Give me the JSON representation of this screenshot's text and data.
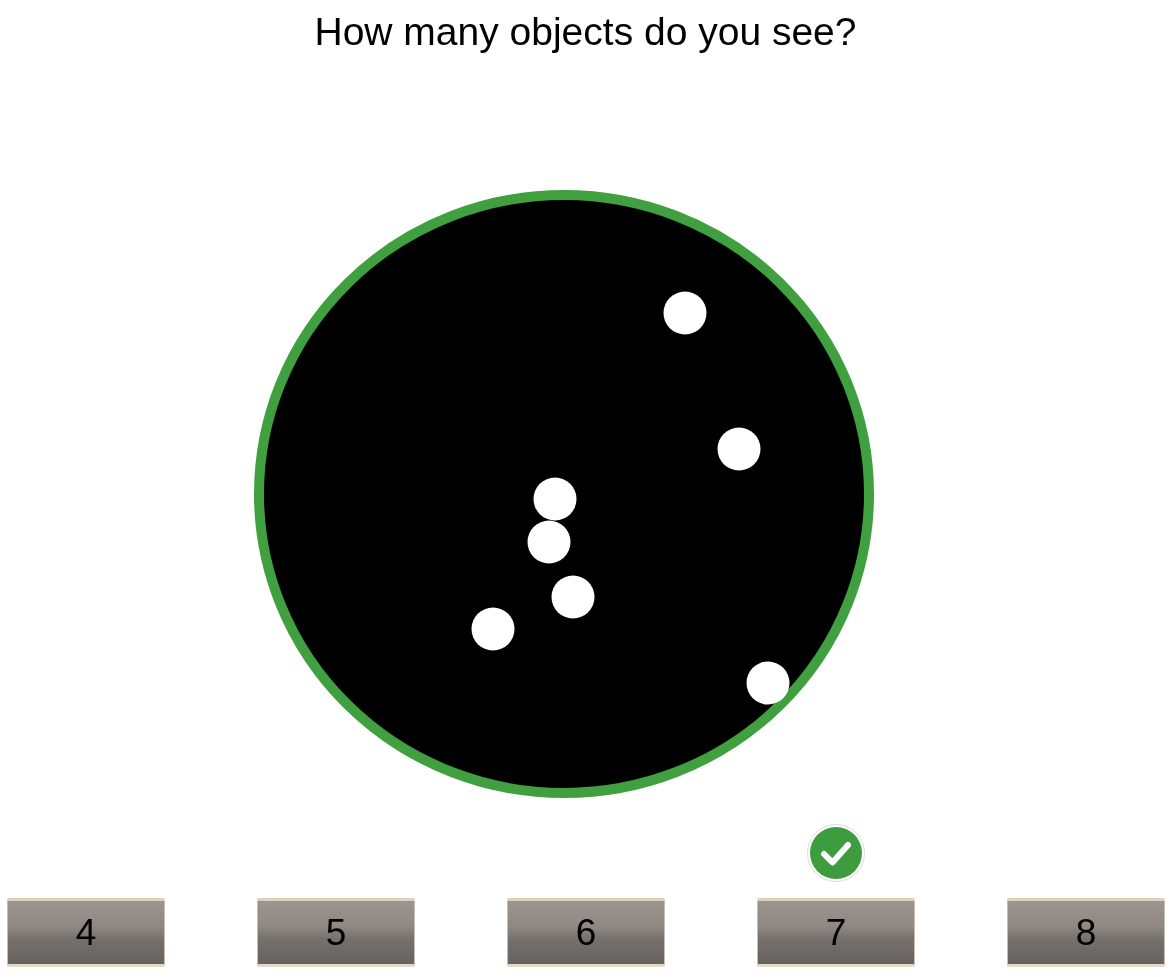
{
  "question": "How many objects do you see?",
  "options": [
    {
      "label": "4",
      "correct": false
    },
    {
      "label": "5",
      "correct": false
    },
    {
      "label": "6",
      "correct": false
    },
    {
      "label": "7",
      "correct": true
    },
    {
      "label": "8",
      "correct": false
    }
  ]
}
